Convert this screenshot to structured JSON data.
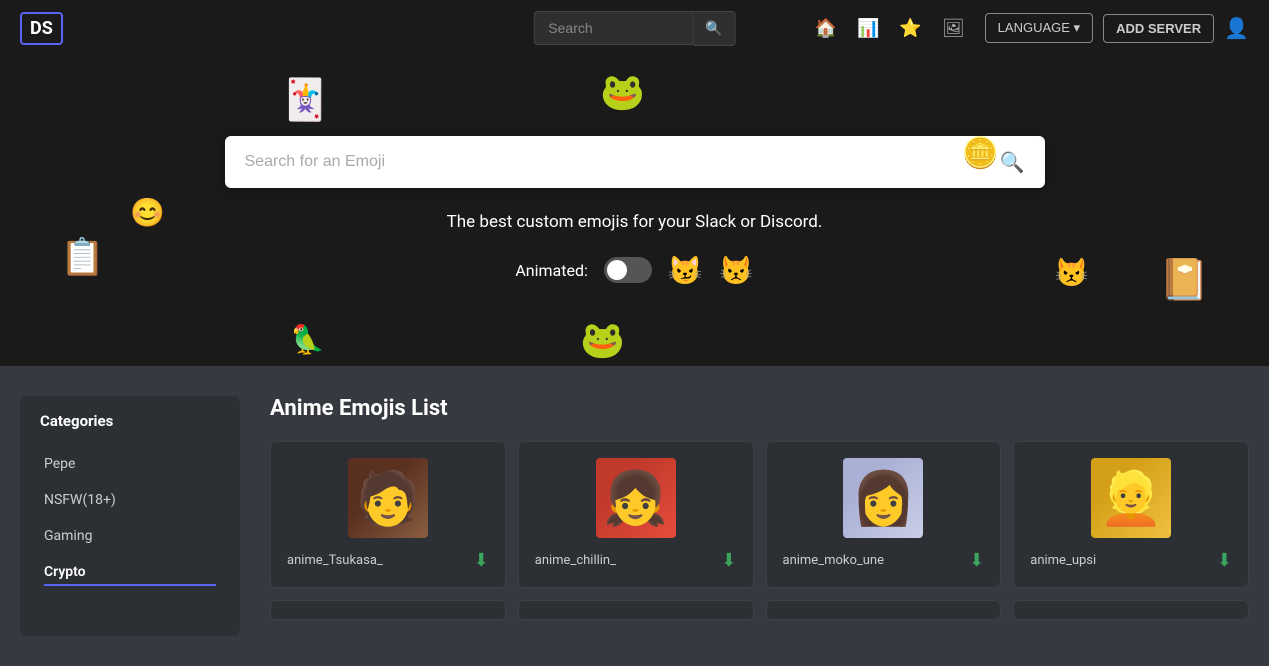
{
  "navbar": {
    "logo": "DS",
    "search_placeholder": "Search",
    "language_label": "LANGUAGE",
    "language_dropdown_icon": "▾",
    "add_server_label": "ADD SERVER",
    "icons": {
      "home": "🏠",
      "chart": "📊",
      "star": "⭐",
      "image": "🖼"
    }
  },
  "hero": {
    "search_placeholder": "Search for an Emoji",
    "tagline": "The best custom emojis for your Slack or Discord.",
    "animated_label": "Animated:",
    "toggle_state": "off"
  },
  "sidebar": {
    "title": "Categories",
    "items": [
      {
        "label": "Pepe",
        "active": false
      },
      {
        "label": "NSFW(18+)",
        "active": false
      },
      {
        "label": "Gaming",
        "active": false
      },
      {
        "label": "Crypto",
        "active": false
      }
    ]
  },
  "emoji_section": {
    "title": "Anime Emojis List",
    "emojis": [
      {
        "name": "anime_Tsukasa_",
        "char_class": "char-tsukasa"
      },
      {
        "name": "anime_chillin_",
        "char_class": "char-chillin"
      },
      {
        "name": "anime_moko_une",
        "char_class": "char-moko"
      },
      {
        "name": "anime_upsi",
        "char_class": "char-upsi"
      }
    ],
    "download_icon": "⬇"
  }
}
